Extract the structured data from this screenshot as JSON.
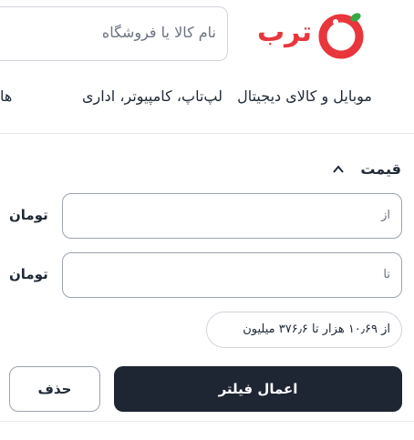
{
  "header": {
    "logo_text": "ترب",
    "search": {
      "placeholder": "نام کالا یا فروشگاه"
    }
  },
  "nav": {
    "items": [
      {
        "label": "موبایل و کالای دیجیتال"
      },
      {
        "label": "لپ‌تاپ، کامپیوتر، اداری"
      },
      {
        "label": "ها"
      }
    ]
  },
  "filter": {
    "section_title": "قیمت",
    "from_placeholder": "از",
    "to_placeholder": "تا",
    "unit_label": "تومان",
    "range_text": "از ۱۰٫۶۹ هزار تا ۳۷۶٫۶ میلیون",
    "apply_label": "اعمال فیلتر",
    "clear_label": "حذف"
  },
  "colors": {
    "brand_red": "#e8363c",
    "brand_green": "#35a845",
    "button_dark": "#1e2533"
  }
}
